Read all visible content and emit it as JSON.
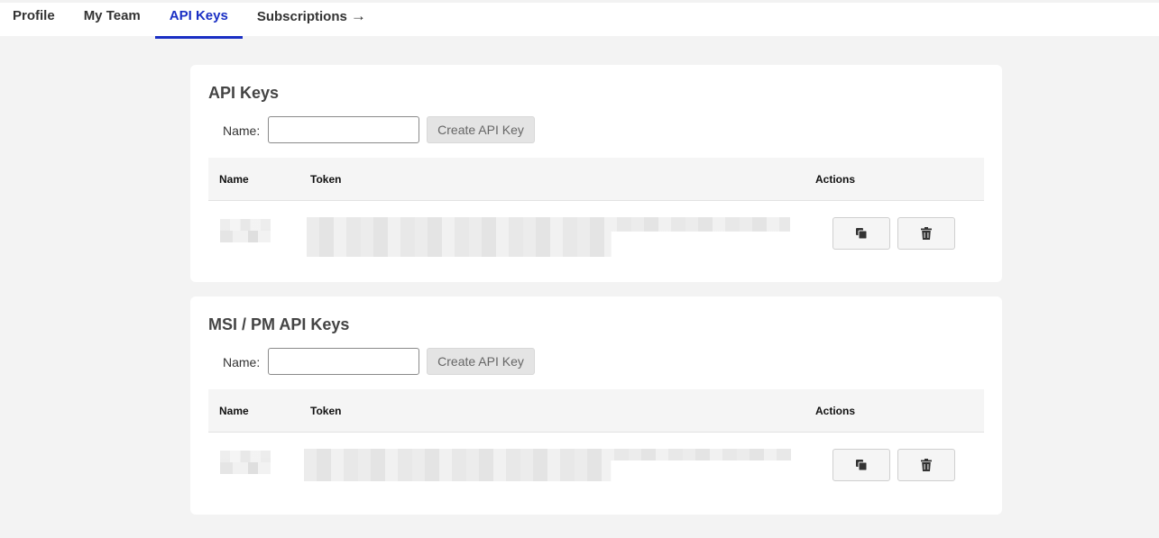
{
  "tabs": [
    {
      "label": "Profile",
      "active": false
    },
    {
      "label": "My Team",
      "active": false
    },
    {
      "label": "API Keys",
      "active": true
    },
    {
      "label": "Subscriptions",
      "active": false,
      "arrow": "→"
    }
  ],
  "colors": {
    "accent": "#1a2fc4",
    "page_bg": "#f3f3f3",
    "card_bg": "#ffffff"
  },
  "sections": [
    {
      "title": "API Keys",
      "name_label": "Name:",
      "name_value": "",
      "create_label": "Create API Key",
      "columns": [
        "Name",
        "Token",
        "Actions"
      ],
      "rows": [
        {
          "name": "",
          "token": "",
          "actions": [
            "copy-icon",
            "trash-icon"
          ]
        }
      ]
    },
    {
      "title": "MSI / PM API Keys",
      "name_label": "Name:",
      "name_value": "",
      "create_label": "Create API Key",
      "columns": [
        "Name",
        "Token",
        "Actions"
      ],
      "rows": [
        {
          "name": "",
          "token": "",
          "actions": [
            "copy-icon",
            "trash-icon"
          ]
        }
      ]
    }
  ]
}
